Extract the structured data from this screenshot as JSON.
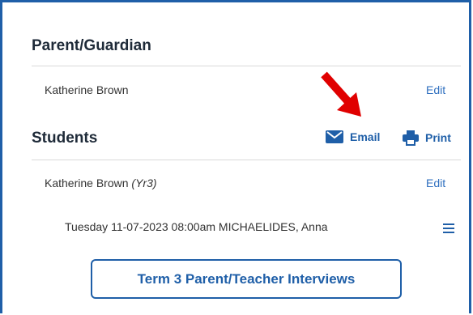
{
  "parent": {
    "title": "Parent/Guardian",
    "name": "Katherine Brown",
    "edit_label": "Edit"
  },
  "students": {
    "title": "Students",
    "email_label": "Email",
    "print_label": "Print",
    "student_name": "Katherine Brown",
    "student_year": "(Yr3)",
    "edit_label": "Edit",
    "appointment": "Tuesday 11-07-2023 08:00am MICHAELIDES, Anna",
    "button_label": "Term 3 Parent/Teacher Interviews"
  },
  "colors": {
    "accent": "#1f5fa8",
    "frame": "#1f5fa8",
    "arrow": "#e00000"
  }
}
